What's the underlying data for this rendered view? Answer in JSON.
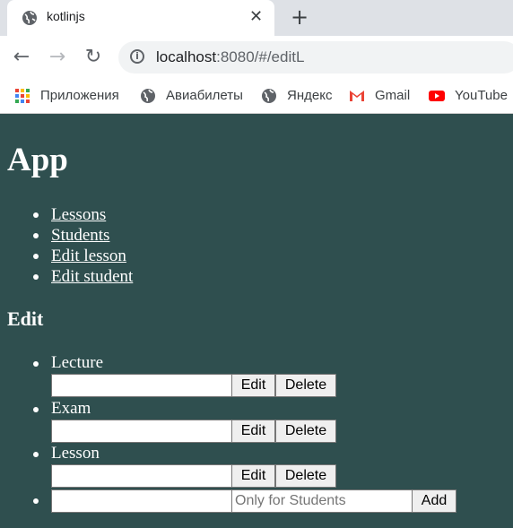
{
  "browser": {
    "tab_title": "kotlinjs",
    "url_host": "localhost",
    "url_path": ":8080/#/editL",
    "bookmarks": [
      "Приложения",
      "Авиабилеты",
      "Яндекс",
      "Gmail",
      "YouTube"
    ]
  },
  "app": {
    "title": "App",
    "nav": [
      "Lessons",
      "Students",
      "Edit lesson",
      "Edit student"
    ],
    "edit_heading": "Edit",
    "lessons": [
      {
        "name": "Lecture",
        "value": "",
        "edit_label": "Edit",
        "delete_label": "Delete"
      },
      {
        "name": "Exam",
        "value": "",
        "edit_label": "Edit",
        "delete_label": "Delete"
      },
      {
        "name": "Lesson",
        "value": "",
        "edit_label": "Edit",
        "delete_label": "Delete"
      }
    ],
    "new_lesson": {
      "name_value": "",
      "extra_placeholder": "Only for Students",
      "add_label": "Add"
    }
  },
  "colors": {
    "page_background": "#2f4f4f",
    "text": "#ffffff"
  }
}
